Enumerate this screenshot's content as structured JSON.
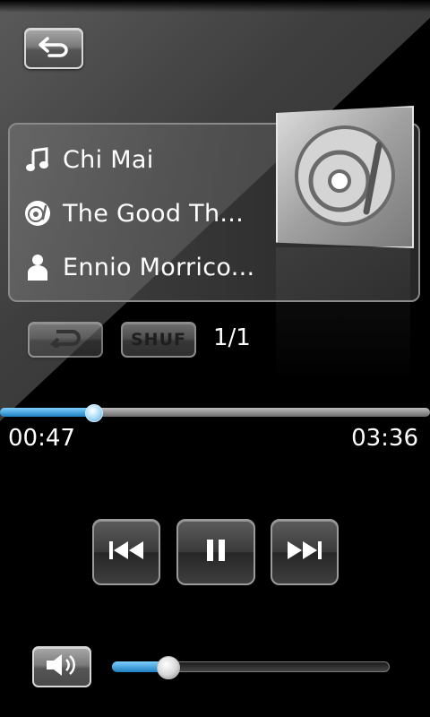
{
  "player": {
    "title": "Chi Mai",
    "album": "The Good Th...",
    "artist": "Ennio Morrico...",
    "shuffle_label": "SHUF",
    "track_position": "1/1",
    "time_elapsed": "00:47",
    "time_total": "03:36",
    "progress": 0.216,
    "volume": 0.2,
    "state": "playing"
  },
  "icons": {
    "back": "back-arrow-icon",
    "title": "music-note-icon",
    "album": "disc-icon",
    "artist": "person-icon",
    "repeat": "repeat-icon",
    "prev": "skip-previous-icon",
    "pause": "pause-icon",
    "next": "skip-next-icon",
    "volume": "speaker-icon"
  },
  "colors": {
    "accent": "#3aa3e3",
    "background": "#000000"
  }
}
